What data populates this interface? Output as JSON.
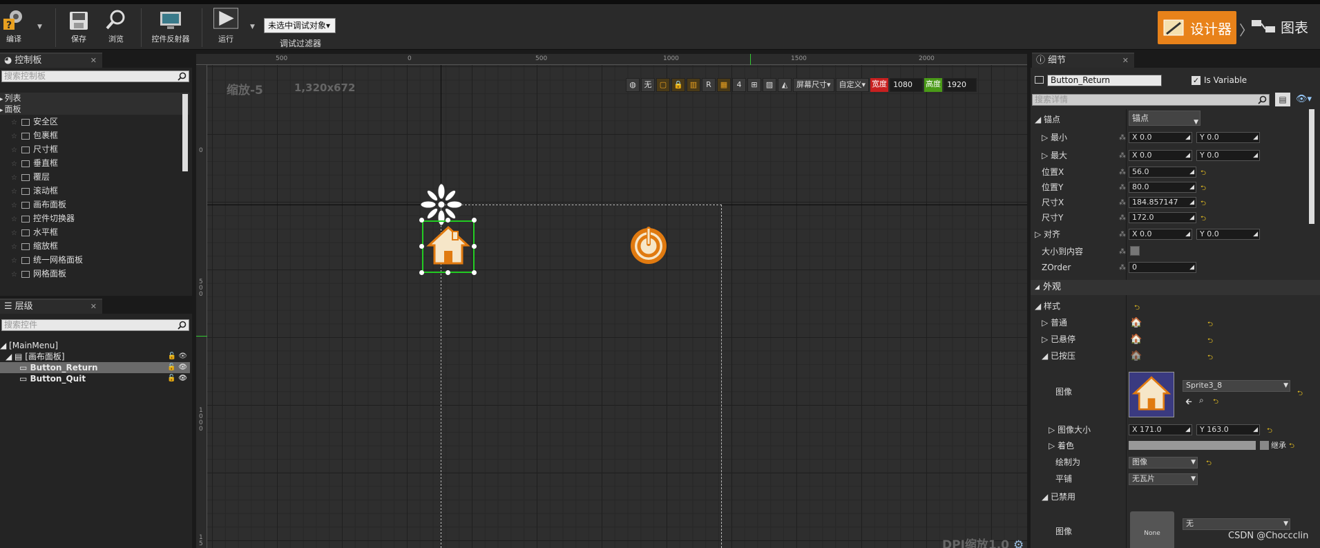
{
  "toolbar": {
    "compile": "编译",
    "save": "保存",
    "browse": "浏览",
    "widget_reflector": "控件反射器",
    "run": "运行",
    "debug_object": "未选中调试对象▾",
    "debug_filter": "调试过滤器",
    "designer": "设计器",
    "graph": "图表"
  },
  "palette": {
    "tab": "控制板",
    "search_placeholder": "搜索控制板",
    "items": [
      {
        "label": "列表",
        "type": "category"
      },
      {
        "label": "面板",
        "type": "category"
      },
      {
        "label": "安全区",
        "type": "item"
      },
      {
        "label": "包裹框",
        "type": "item"
      },
      {
        "label": "尺寸框",
        "type": "item"
      },
      {
        "label": "垂直框",
        "type": "item"
      },
      {
        "label": "覆层",
        "type": "item"
      },
      {
        "label": "滚动框",
        "type": "item"
      },
      {
        "label": "画布面板",
        "type": "item"
      },
      {
        "label": "控件切换器",
        "type": "item"
      },
      {
        "label": "水平框",
        "type": "item"
      },
      {
        "label": "缩放框",
        "type": "item"
      },
      {
        "label": "统一网格面板",
        "type": "item"
      },
      {
        "label": "网格面板",
        "type": "item"
      }
    ]
  },
  "hierarchy": {
    "tab": "层级",
    "search_placeholder": "搜索控件",
    "root": "[MainMenu]",
    "canvas": "[画布面板]",
    "children": [
      "Button_Return",
      "Button_Quit"
    ]
  },
  "viewport": {
    "zoom": "缩放-5",
    "resolution": "1,320x672",
    "dpi": "DPI缩放1.0",
    "ruler_top": [
      "500",
      "0",
      "500",
      "1000",
      "1500",
      "2000"
    ],
    "ruler_left": [
      {
        "text": "0"
      },
      {
        "text": "5\n0\n0"
      },
      {
        "text": "1\n0\n0\n0"
      },
      {
        "text": "1\n5"
      }
    ],
    "toolbar": {
      "none": "无",
      "r": "R",
      "num": "4",
      "screen_size": "屏幕尺寸▾",
      "custom": "自定义▾",
      "width_lbl": "宽度",
      "width_val": "1080",
      "height_lbl": "高度",
      "height_val": "1920"
    }
  },
  "details": {
    "tab": "细节",
    "name": "Button_Return",
    "is_variable": "Is Variable",
    "search_placeholder": "搜索详情",
    "anchor_lbl": "锚点",
    "anchor_val": "锚点",
    "rows": [
      {
        "label": "最小",
        "x": "X  0.0",
        "y": "Y  0.0"
      },
      {
        "label": "最大",
        "x": "X  0.0",
        "y": "Y  0.0"
      }
    ],
    "single": [
      {
        "label": "位置X",
        "val": "56.0"
      },
      {
        "label": "位置Y",
        "val": "80.0"
      },
      {
        "label": "尺寸X",
        "val": "184.857147"
      },
      {
        "label": "尺寸Y",
        "val": "172.0"
      }
    ],
    "align": {
      "label": "对齐",
      "x": "X  0.0",
      "y": "Y  0.0"
    },
    "size_to_content": "大小到内容",
    "zorder": {
      "label": "ZOrder",
      "val": "0"
    },
    "appearance": "外观",
    "style": "样式",
    "normal": "普通",
    "hovered": "已悬停",
    "pressed": "已按压",
    "image_lbl": "图像",
    "sprite": "Sprite3_8",
    "image_size": {
      "label": "图像大小",
      "x": "X  171.0",
      "y": "Y  163.0"
    },
    "tint": "着色",
    "inherit": "继承",
    "draw_as": {
      "label": "绘制为",
      "val": "图像"
    },
    "tiling": {
      "label": "平铺",
      "val": "无瓦片"
    },
    "disabled": "已禁用",
    "image2_lbl": "图像",
    "none_thumb": "None",
    "none_val": "无"
  },
  "watermark": "CSDN @Choccclin"
}
